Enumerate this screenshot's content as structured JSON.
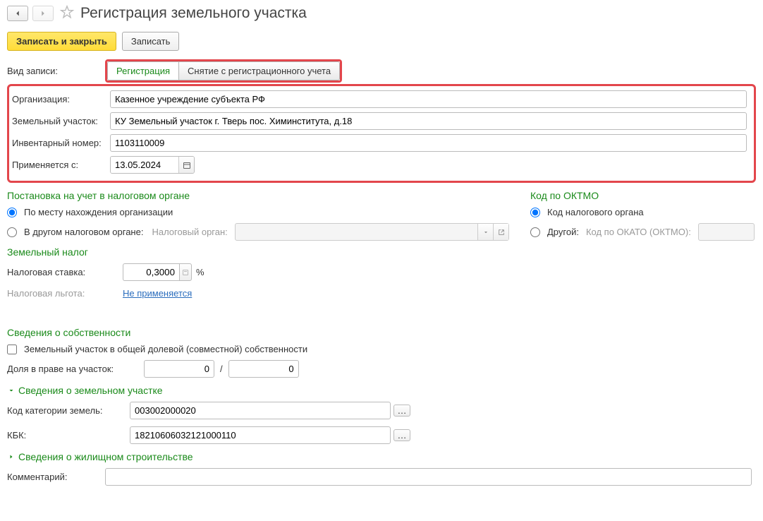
{
  "header": {
    "title": "Регистрация земельного участка"
  },
  "toolbar": {
    "save_close": "Записать и закрыть",
    "save": "Записать"
  },
  "form": {
    "record_type_label": "Вид записи:",
    "tab_register": "Регистрация",
    "tab_deregister": "Снятие с регистрационного учета",
    "org_label": "Организация:",
    "org_value": "Казенное учреждение субъекта РФ",
    "land_label": "Земельный участок:",
    "land_value": "КУ Земельный участок г. Тверь пос. Химинститута, д.18",
    "inv_label": "Инвентарный номер:",
    "inv_value": "1103110009",
    "date_label": "Применяется с:",
    "date_value": "13.05.2024"
  },
  "tax_reg": {
    "title": "Постановка на учет в налоговом органе",
    "opt1": "По месту нахождения организации",
    "opt2": "В другом налоговом органе:",
    "tax_org_label": "Налоговый орган:"
  },
  "oktmo": {
    "title": "Код по ОКТМО",
    "opt1": "Код налогового органа",
    "opt2": "Другой:",
    "okato_label": "Код по ОКАТО (ОКТМО):"
  },
  "land_tax": {
    "title": "Земельный налог",
    "rate_label": "Налоговая ставка:",
    "rate_value": "0,3000",
    "pct": "%",
    "benefit_label": "Налоговая льгота:",
    "benefit_link": "Не применяется"
  },
  "ownership": {
    "title": "Сведения о собственности",
    "shared_label": "Земельный участок в общей долевой (совместной) собственности",
    "share_label": "Доля в праве на участок:",
    "share_num": "0",
    "share_den": "0"
  },
  "details": {
    "collapser": "Сведения о земельном участке",
    "cat_label": "Код категории земель:",
    "cat_value": "003002000020",
    "kbk_label": "КБК:",
    "kbk_value": "18210606032121000110"
  },
  "housing": {
    "collapser": "Сведения о жилищном строительстве"
  },
  "comment": {
    "label": "Комментарий:",
    "value": ""
  },
  "slash": "/"
}
